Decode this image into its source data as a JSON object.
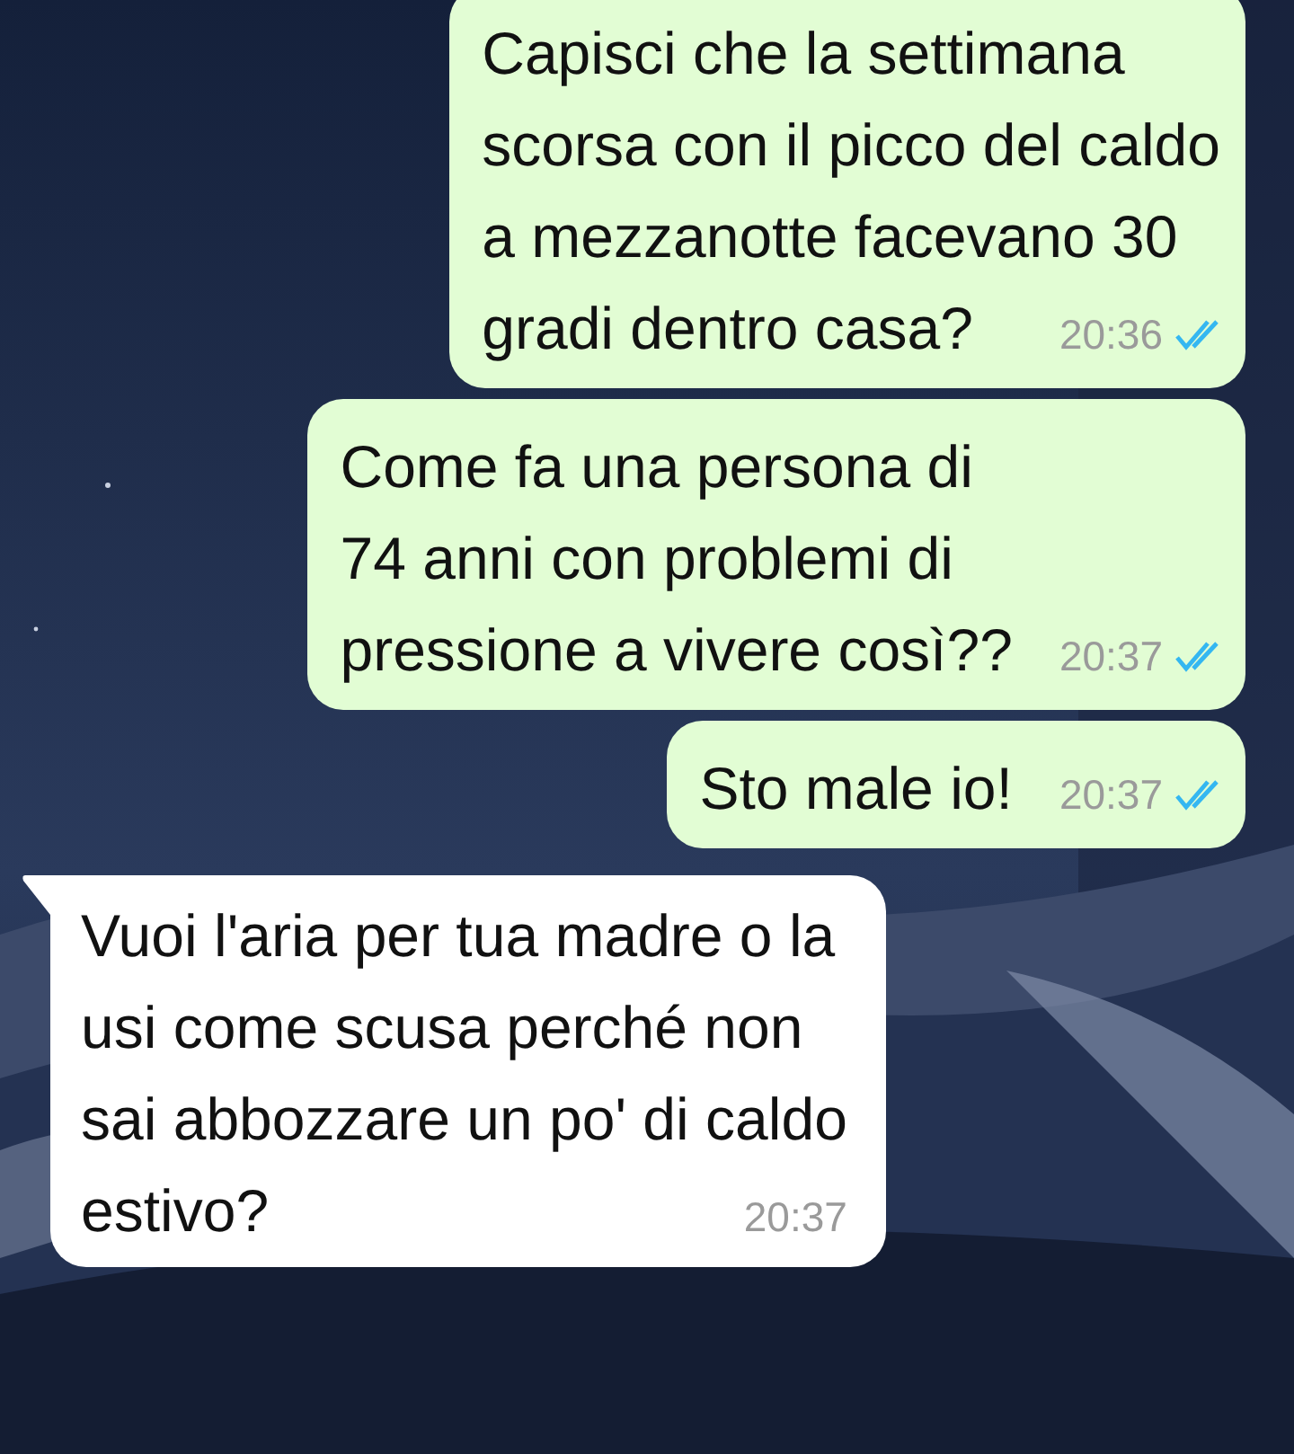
{
  "messages": [
    {
      "kind": "outgoing",
      "lines": [
        "Capisci che la settimana",
        "scorsa con il picco del caldo",
        "a mezzanotte facevano 30",
        "gradi dentro casa?"
      ],
      "time": "20:36",
      "read": true
    },
    {
      "kind": "outgoing",
      "lines": [
        "Come fa una persona di",
        "74 anni con problemi di",
        "pressione a vivere così??"
      ],
      "time": "20:37",
      "read": true
    },
    {
      "kind": "outgoing",
      "lines": [
        "Sto male io!"
      ],
      "time": "20:37",
      "read": true
    },
    {
      "kind": "incoming",
      "lines": [
        "Vuoi l'aria per tua madre o la",
        "usi come scusa perché non",
        "sai abbozzare un po' di caldo",
        "estivo?"
      ],
      "time": "20:37"
    }
  ]
}
